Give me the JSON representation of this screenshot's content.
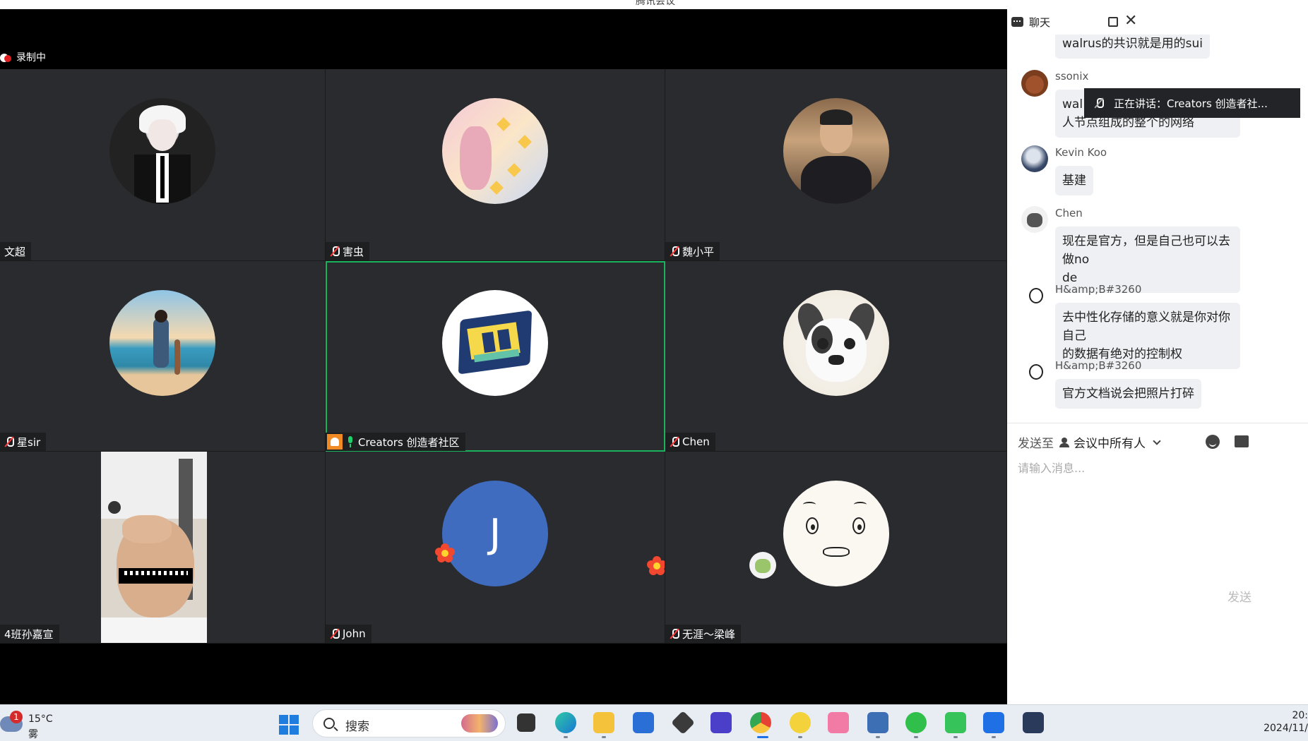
{
  "window": {
    "title": "腾讯会议"
  },
  "recording": {
    "label": "录制中"
  },
  "participants": [
    {
      "name": "文超",
      "muted": false,
      "avatar": "anime-avatar"
    },
    {
      "name": "害虫",
      "muted": true,
      "avatar": "pastel-illustration-avatar"
    },
    {
      "name": "魏小平",
      "muted": true,
      "avatar": "man-portrait-avatar"
    },
    {
      "name": "星sir",
      "muted": true,
      "avatar": "beach-kid-avatar"
    },
    {
      "name": "Creators 创造者社区",
      "muted": false,
      "speaking": true,
      "host": true,
      "avatar": "creators-logo-avatar"
    },
    {
      "name": "Chen",
      "muted": true,
      "avatar": "bulldog-avatar"
    },
    {
      "name": "4班孙嘉宣",
      "muted": false,
      "video": true,
      "avatar": "camera-feed"
    },
    {
      "name": "John",
      "muted": true,
      "avatar": "letter-avatar",
      "initial": "J"
    },
    {
      "name": "无涯～梁峰",
      "muted": true,
      "avatar": "meme-face-avatar"
    }
  ],
  "chat": {
    "title": "聊天",
    "messages": [
      {
        "sender": "",
        "text": "walrus的共识就是用的sui"
      },
      {
        "sender": "ssonix",
        "text_line1": "wal",
        "text_line2": "人节点组成的整个的网络"
      },
      {
        "sender": "Kevin Koo",
        "text": "基建"
      },
      {
        "sender": "Chen",
        "text_line1": "现在是官方，但是自己也可以去做no",
        "text_line2": "de"
      },
      {
        "sender": "H&amp;B#3260",
        "text_line1": "去中性化存储的意义就是你对你自己",
        "text_line2": "的数据有绝对的控制权"
      },
      {
        "sender": "H&amp;B#3260",
        "text": "官方文档说会把照片打碎"
      }
    ],
    "speaking_toast": "正在讲话：Creators 创造者社...",
    "compose": {
      "send_to_label": "发送至",
      "recipient": "会议中所有人",
      "placeholder": "请输入消息...",
      "send_label": "发送"
    }
  },
  "taskbar": {
    "weather": {
      "temp": "15°C",
      "condition": "雾",
      "badge": "1"
    },
    "search_label": "搜索",
    "clock": {
      "time": "20:",
      "date": "2024/11/"
    },
    "apps": [
      "file-explorer-icon",
      "edge-icon",
      "folder-icon",
      "store-icon",
      "unity-icon",
      "visual-studio-icon",
      "chrome-icon",
      "music-icon",
      "bilibili-icon",
      "remote-desktop-icon",
      "wechat-icon",
      "screen-share-icon",
      "tencent-meeting-icon",
      "cat-icon"
    ]
  }
}
